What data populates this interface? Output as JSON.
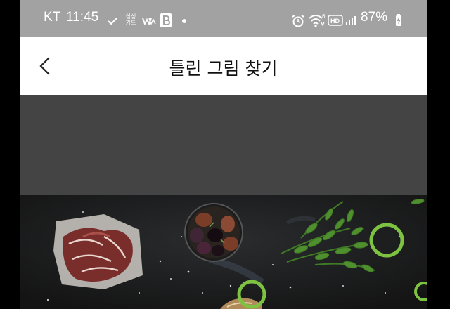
{
  "status_bar": {
    "carrier": "KT",
    "time": "11:45",
    "notif_app_line1": "삼성",
    "notif_app_line2": "카드",
    "battery": "87%",
    "icons": [
      "check-icon",
      "samsung-card-icon",
      "w-app-icon",
      "b-app-icon",
      "dot-icon",
      "alarm-icon",
      "wifi-6-icon",
      "hd-icon",
      "signal-icon",
      "battery-charging-icon"
    ]
  },
  "app_bar": {
    "title": "틀린 그림 찾기",
    "back_icon": "chevron-left-icon"
  },
  "game": {
    "found_markers": 3,
    "marker_color": "#7ec242"
  },
  "colors": {
    "status_bar": "#a2a2a2",
    "app_bar": "#ffffff",
    "banner": "#444444",
    "board": "#161616"
  }
}
